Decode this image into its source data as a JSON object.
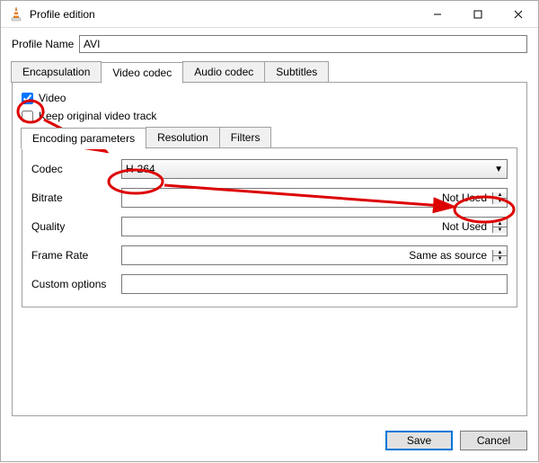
{
  "window": {
    "title": "Profile edition"
  },
  "profile_name": {
    "label": "Profile Name",
    "value": "AVI"
  },
  "tabs": {
    "encapsulation": "Encapsulation",
    "video_codec": "Video codec",
    "audio_codec": "Audio codec",
    "subtitles": "Subtitles"
  },
  "video_section": {
    "video_chk_label": "Video",
    "video_chk_checked": true,
    "keep_original_label": "Keep original video track",
    "keep_original_checked": false
  },
  "inner_tabs": {
    "encoding": "Encoding parameters",
    "resolution": "Resolution",
    "filters": "Filters"
  },
  "encoding": {
    "codec_label": "Codec",
    "codec_value": "H-264",
    "bitrate_label": "Bitrate",
    "bitrate_value": "Not Used",
    "quality_label": "Quality",
    "quality_value": "Not Used",
    "framerate_label": "Frame Rate",
    "framerate_value": "Same as source",
    "custom_label": "Custom options",
    "custom_value": ""
  },
  "footer": {
    "save": "Save",
    "cancel": "Cancel"
  }
}
